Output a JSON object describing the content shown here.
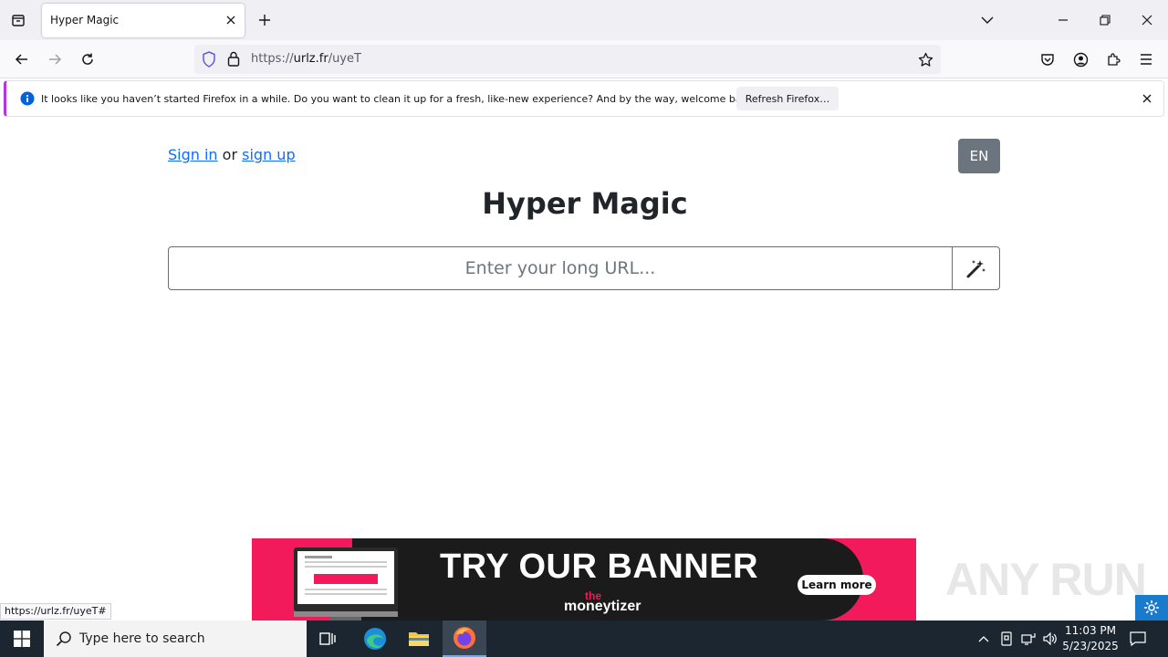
{
  "browser": {
    "tab": {
      "title": "Hyper Magic"
    },
    "url": {
      "prefix": "https://",
      "domain": "urlz.fr",
      "path": "/uyeT"
    },
    "notification": {
      "message": "It looks like you haven’t started Firefox in a while. Do you want to clean it up for a fresh, like-new experience? And by the way, welcome back!",
      "button": "Refresh Firefox…"
    },
    "status_link": "https://urlz.fr/uyeT#"
  },
  "page": {
    "auth": {
      "sign_in": "Sign in",
      "or": "or",
      "sign_up": "sign up"
    },
    "language": "EN",
    "title": "Hyper Magic",
    "url_input_placeholder": "Enter your long URL..."
  },
  "banner": {
    "headline": "TRY OUR BANNER",
    "cta": "Learn more",
    "brand_top": "the",
    "brand_bottom": "moneytizer"
  },
  "watermark": "ANY RUN",
  "taskbar": {
    "search_placeholder": "Type here to search",
    "time": "11:03 PM",
    "date": "5/23/2025"
  },
  "colors": {
    "link": "#0d6efd",
    "lang_button": "#6c757d",
    "banner_pink": "#f21a5a",
    "taskbar": "#1c2630"
  }
}
